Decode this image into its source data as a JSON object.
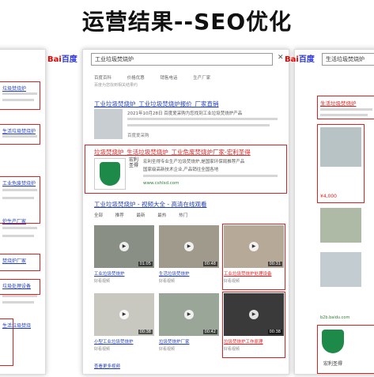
{
  "page": {
    "title": "运营结果--SEO优化"
  },
  "center": {
    "search_query": "工业垃圾焚烧炉",
    "tabs": [
      "百度百科",
      "价格优惠",
      "销售电话",
      "生产厂家"
    ],
    "stat": "百度为您找到相关结果约",
    "res1": {
      "title": "工业垃圾焚烧炉_工业垃圾焚烧炉报价_厂家直销",
      "snippet": "2021年10月28日 百度爱采购为您找到工业垃圾焚烧炉产品",
      "source": "百度爱采购"
    },
    "res2": {
      "title": "垃圾焚烧炉_生活垃圾焚烧炉_工业危废焚烧炉厂家-宏利圣得",
      "snippet1": "宏利圣得专业生产垃圾焚烧炉,是国家环保局推荐产品",
      "snippet2": "国家级高新技术企业,产品销往全国各地",
      "url": "www.cshlsd.com",
      "badge": "宏利圣得"
    },
    "video_header": "工业垃圾焚烧炉 - 视频大全 - 高清在线观看",
    "video_tabs": [
      "全部",
      "推荐",
      "最新",
      "最热",
      "热门"
    ],
    "videos": [
      {
        "caption": "工业垃圾焚烧炉",
        "src": "好看视频",
        "dur": "01:05"
      },
      {
        "caption": "生活垃圾焚烧炉",
        "src": "好看视频",
        "dur": "00:48"
      },
      {
        "caption": "工业垃圾焚烧炉处理设备",
        "src": "好看视频",
        "dur": "00:31"
      },
      {
        "caption": "小型工业垃圾焚烧炉",
        "src": "好看视频",
        "dur": "00:38"
      },
      {
        "caption": "垃圾焚烧炉厂家",
        "src": "好看视频",
        "dur": "00:42"
      },
      {
        "caption": "垃圾焚烧炉工作原理",
        "src": "好看视频",
        "dur": "00:38"
      }
    ],
    "more": "查看更多视频"
  },
  "left": {
    "items": [
      "垃圾焚烧炉",
      "生活垃圾焚烧炉",
      "工业危废焚烧炉",
      "炉生产厂家",
      "焚烧炉厂家",
      "垃圾处理设备",
      "生活垃圾焚烧"
    ]
  },
  "right": {
    "search_query": "生活垃圾焚烧炉",
    "title": "生活垃圾焚烧炉",
    "price": "¥4,000",
    "badge": "宏利圣得",
    "url": "b2b.baidu.com"
  },
  "baidu": {
    "bai": "Bai",
    "du": "百度"
  }
}
